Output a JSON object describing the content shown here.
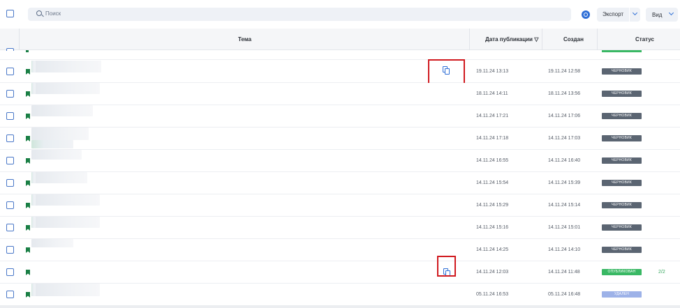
{
  "toolbar": {
    "search_placeholder": "Поиск",
    "export_label": "Экспорт",
    "view_label": "Вид"
  },
  "table": {
    "headers": {
      "topic": "Тема",
      "published": "Дата публикации",
      "sort_indicator": "▽",
      "created": "Создан",
      "status": "Статус"
    },
    "rows": [
      {
        "published": "19.11.24 13:13",
        "created": "19.11.24 12:58",
        "status": "ЧЕРНОВИК",
        "status_kind": "draft",
        "counter": "",
        "copy_icon": true,
        "highlighted": true
      },
      {
        "published": "18.11.24 14:11",
        "created": "18.11.24 13:56",
        "status": "ЧЕРНОВИК",
        "status_kind": "draft",
        "counter": "",
        "copy_icon": false,
        "highlighted": false
      },
      {
        "published": "14.11.24 17:21",
        "created": "14.11.24 17:06",
        "status": "ЧЕРНОВИК",
        "status_kind": "draft",
        "counter": "",
        "copy_icon": false,
        "highlighted": false
      },
      {
        "published": "14.11.24 17:18",
        "created": "14.11.24 17:03",
        "status": "ЧЕРНОВИК",
        "status_kind": "draft",
        "counter": "",
        "copy_icon": false,
        "highlighted": false
      },
      {
        "published": "14.11.24 16:55",
        "created": "14.11.24 16:40",
        "status": "ЧЕРНОВИК",
        "status_kind": "draft",
        "counter": "",
        "copy_icon": false,
        "highlighted": false
      },
      {
        "published": "14.11.24 15:54",
        "created": "14.11.24 15:39",
        "status": "ЧЕРНОВИК",
        "status_kind": "draft",
        "counter": "",
        "copy_icon": false,
        "highlighted": false
      },
      {
        "published": "14.11.24 15:29",
        "created": "14.11.24 15:14",
        "status": "ЧЕРНОВИК",
        "status_kind": "draft",
        "counter": "",
        "copy_icon": false,
        "highlighted": false
      },
      {
        "published": "14.11.24 15:16",
        "created": "14.11.24 15:01",
        "status": "ЧЕРНОВИК",
        "status_kind": "draft",
        "counter": "",
        "copy_icon": false,
        "highlighted": false
      },
      {
        "published": "14.11.24 14:25",
        "created": "14.11.24 14:10",
        "status": "ЧЕРНОВИК",
        "status_kind": "draft",
        "counter": "",
        "copy_icon": false,
        "highlighted": false
      },
      {
        "published": "14.11.24 12:03",
        "created": "14.11.24 11:48",
        "status": "ОПУБЛИКОВАН",
        "status_kind": "pub",
        "counter": "2/2",
        "copy_icon": true,
        "highlighted": true
      },
      {
        "published": "05.11.24 16:53",
        "created": "05.11.24 16:48",
        "status": "УДАЛЕН",
        "status_kind": "del",
        "counter": "",
        "copy_icon": false,
        "highlighted": false
      }
    ]
  },
  "colors": {
    "accent": "#2f6fd6",
    "draft": "#5b6572",
    "published": "#39b864",
    "deleted": "#9db2e8",
    "highlight": "#d0191f",
    "bookmark": "#1a7f45"
  },
  "icons": [
    "search-icon",
    "help-icon",
    "chevron-down-icon",
    "bookmark-icon",
    "copy-icon"
  ]
}
